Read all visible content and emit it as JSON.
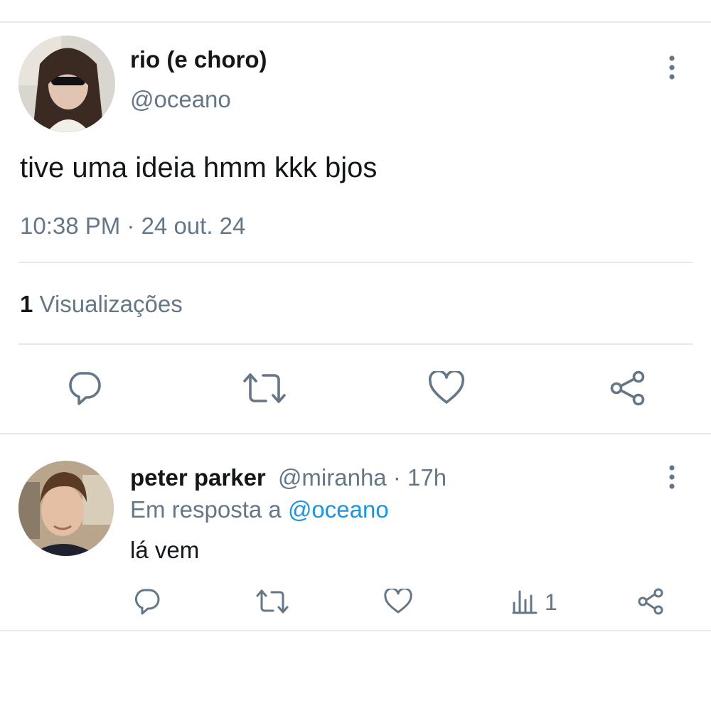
{
  "tweet": {
    "display_name": "rio (e choro)",
    "handle": "@oceano",
    "text": "tive uma ideia hmm kkk bjos",
    "timestamp": "10:38 PM · 24 out. 24",
    "views_count": "1",
    "views_label": "Visualizações",
    "actions": {
      "reply": "reply-icon",
      "retweet": "retweet-icon",
      "like": "heart-icon",
      "share": "share-icon"
    }
  },
  "reply": {
    "display_name": "peter parker",
    "handle": "@miranha",
    "time": "· 17h",
    "in_reply_prefix": "Em resposta a",
    "in_reply_handle": "@oceano",
    "text": "lá vem",
    "views": "1"
  },
  "colors": {
    "text": "#14171a",
    "muted": "#657786",
    "link": "#1b95e0",
    "divider": "#e6e9ec",
    "icon": "#657786"
  }
}
